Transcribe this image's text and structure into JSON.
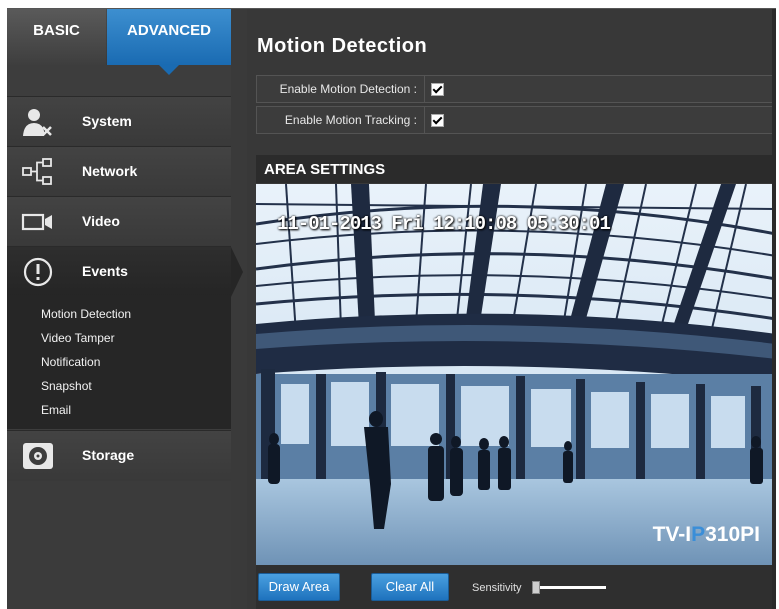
{
  "tabs": {
    "basic": "BASIC",
    "advanced": "ADVANCED"
  },
  "sidebar": {
    "items": [
      {
        "label": "System",
        "icon": "user-settings-icon"
      },
      {
        "label": "Network",
        "icon": "network-icon"
      },
      {
        "label": "Video",
        "icon": "video-camera-icon"
      },
      {
        "label": "Events",
        "icon": "alert-icon"
      },
      {
        "label": "Storage",
        "icon": "disk-icon"
      }
    ],
    "events_submenu": [
      "Motion Detection",
      "Video Tamper",
      "Notification",
      "Snapshot",
      "Email"
    ]
  },
  "main": {
    "title": "Motion Detection",
    "fields": [
      {
        "label": "Enable Motion Detection :",
        "checked": true
      },
      {
        "label": "Enable Motion Tracking :",
        "checked": true
      }
    ],
    "area_title": "AREA SETTINGS",
    "video": {
      "timestamp": "11-01-2013 Fri 12:10:08 05:30:01",
      "brand_prefix": "TV-I",
      "brand_accent": "P",
      "brand_suffix": "310PI"
    },
    "buttons": {
      "draw_area": "Draw Area",
      "clear_all": "Clear All"
    },
    "sensitivity_label": "Sensitivity",
    "sensitivity_value": 0.0
  },
  "colors": {
    "accent": "#1a6bb2",
    "panel": "#383838",
    "sidebar": "#3d3d3d"
  }
}
